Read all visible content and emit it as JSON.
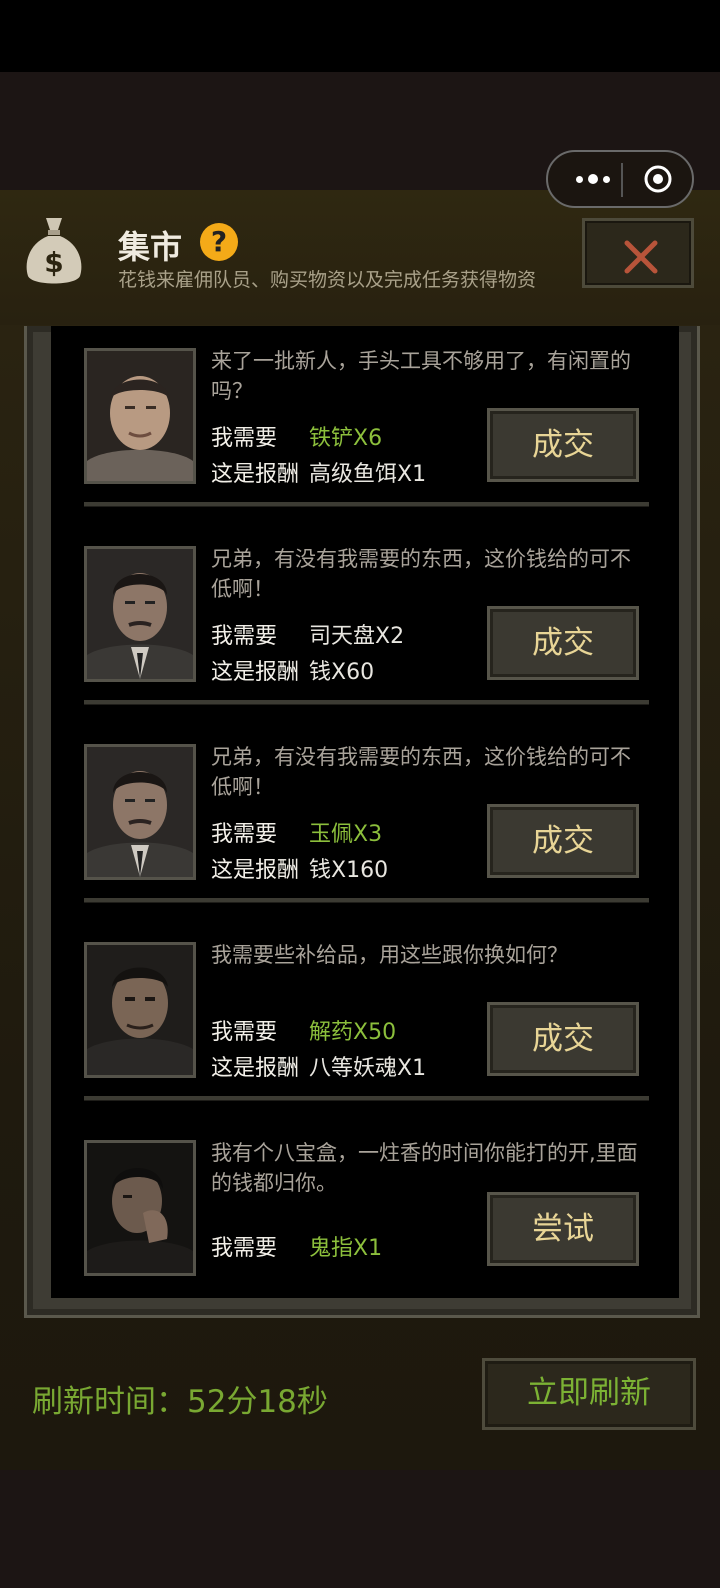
{
  "header": {
    "title": "集市",
    "help": "?",
    "subtitle": "花钱来雇佣队员、购买物资以及完成任务获得物资"
  },
  "capsule": {
    "more": "more-icon",
    "close": "target-icon"
  },
  "offers": [
    {
      "desc": "来了一批新人，手头工具不够用了，有闲置的吗？",
      "need_label": "我需要",
      "need": "铁铲X6",
      "need_highlight": true,
      "reward_label": "这是报酬",
      "reward": "高级鱼饵X1",
      "button": "成交"
    },
    {
      "desc": "兄弟，有没有我需要的东西，这价钱给的可不低啊！",
      "need_label": "我需要",
      "need": "司天盘X2",
      "need_highlight": false,
      "reward_label": "这是报酬",
      "reward": "钱X60",
      "button": "成交"
    },
    {
      "desc": "兄弟，有没有我需要的东西，这价钱给的可不低啊！",
      "need_label": "我需要",
      "need": "玉佩X3",
      "need_highlight": true,
      "reward_label": "这是报酬",
      "reward": "钱X160",
      "button": "成交"
    },
    {
      "desc": "我需要些补给品，用这些跟你换如何？",
      "need_label": "我需要",
      "need": "解药X50",
      "need_highlight": true,
      "reward_label": "这是报酬",
      "reward": "八等妖魂X1",
      "button": "成交"
    },
    {
      "desc": "我有个八宝盒，一炷香的时间你能打的开,里面的钱都归你。",
      "need_label": "我需要",
      "need": "鬼指X1",
      "need_highlight": true,
      "button": "尝试"
    }
  ],
  "footer": {
    "refresh_time": "刷新时间：52分18秒",
    "refresh_button": "立即刷新"
  },
  "colors": {
    "highlight_green": "#8cbf3c",
    "button_text": "#e8d596",
    "help_icon": "#f4aa18",
    "close_x": "#b8543a"
  }
}
